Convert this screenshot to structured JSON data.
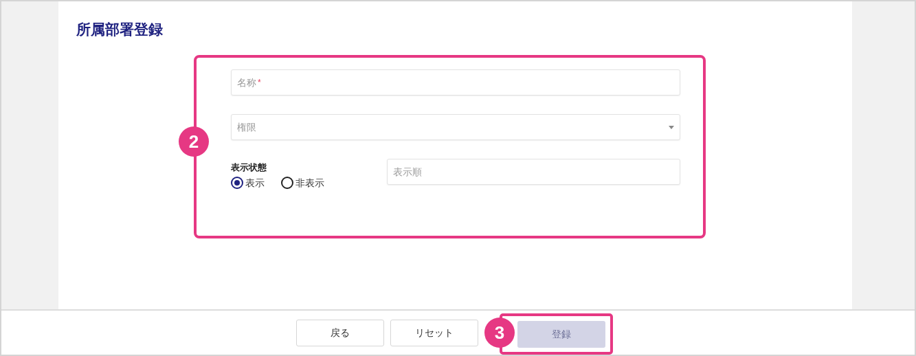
{
  "title": "所属部署登録",
  "form": {
    "name_field": {
      "placeholder": "名称",
      "required_mark": "*"
    },
    "authority_select": {
      "placeholder": "権限"
    },
    "display_status": {
      "label": "表示状態",
      "options": [
        {
          "label": "表示",
          "selected": true
        },
        {
          "label": "非表示",
          "selected": false
        }
      ]
    },
    "order_field": {
      "placeholder": "表示順"
    }
  },
  "buttons": [
    {
      "label": "戻る",
      "disabled": false
    },
    {
      "label": "リセット",
      "disabled": false
    },
    {
      "label": "登録",
      "disabled": true
    }
  ],
  "callouts": [
    {
      "number": "2"
    },
    {
      "number": "3"
    }
  ]
}
